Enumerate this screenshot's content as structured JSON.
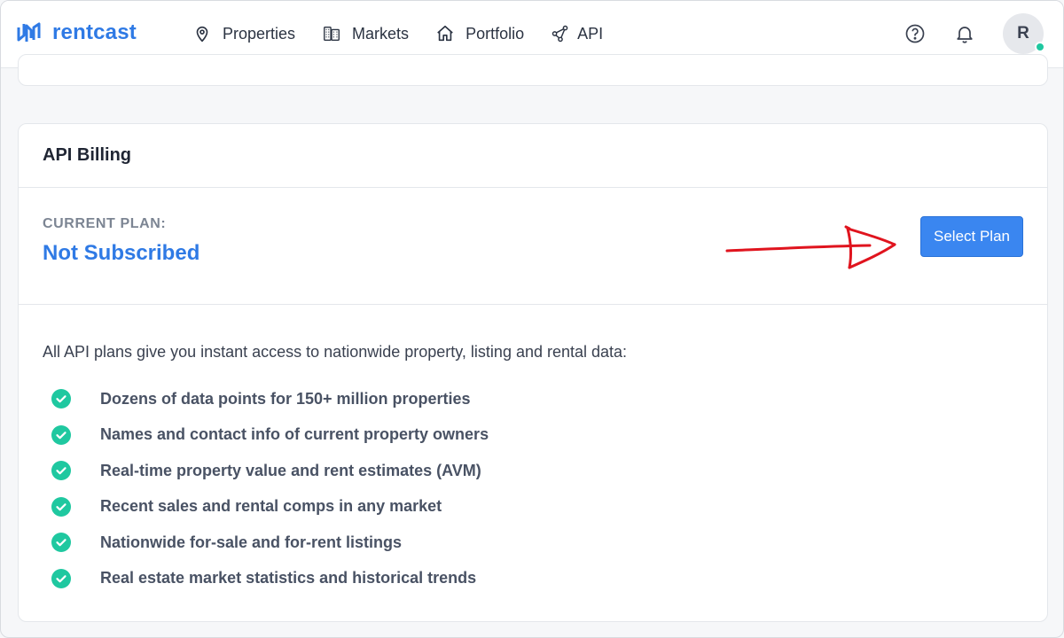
{
  "brand": {
    "name": "rentcast",
    "accent": "#2f7ae5"
  },
  "nav": {
    "items": [
      {
        "label": "Properties",
        "icon": "map-pin-icon"
      },
      {
        "label": "Markets",
        "icon": "buildings-icon"
      },
      {
        "label": "Portfolio",
        "icon": "home-icon"
      },
      {
        "label": "API",
        "icon": "share-nodes-icon"
      }
    ]
  },
  "tools": {
    "help_icon": "help-circle-icon",
    "notifications_icon": "bell-icon"
  },
  "user": {
    "initial": "R",
    "status_color": "#1fc8a0"
  },
  "billing": {
    "title": "API Billing",
    "current_plan_label": "CURRENT PLAN:",
    "current_plan_value": "Not Subscribed",
    "select_plan_label": "Select Plan",
    "button_color": "#3a86f0",
    "annotation_color": "#e0141e"
  },
  "features": {
    "intro": "All API plans give you instant access to nationwide property, listing and rental data:",
    "items": [
      "Dozens of data points for 150+ million properties",
      "Names and contact info of current property owners",
      "Real-time property value and rent estimates (AVM)",
      "Recent sales and rental comps in any market",
      "Nationwide for-sale and for-rent listings",
      "Real estate market statistics and historical trends"
    ],
    "check_color": "#1fc8a0"
  }
}
